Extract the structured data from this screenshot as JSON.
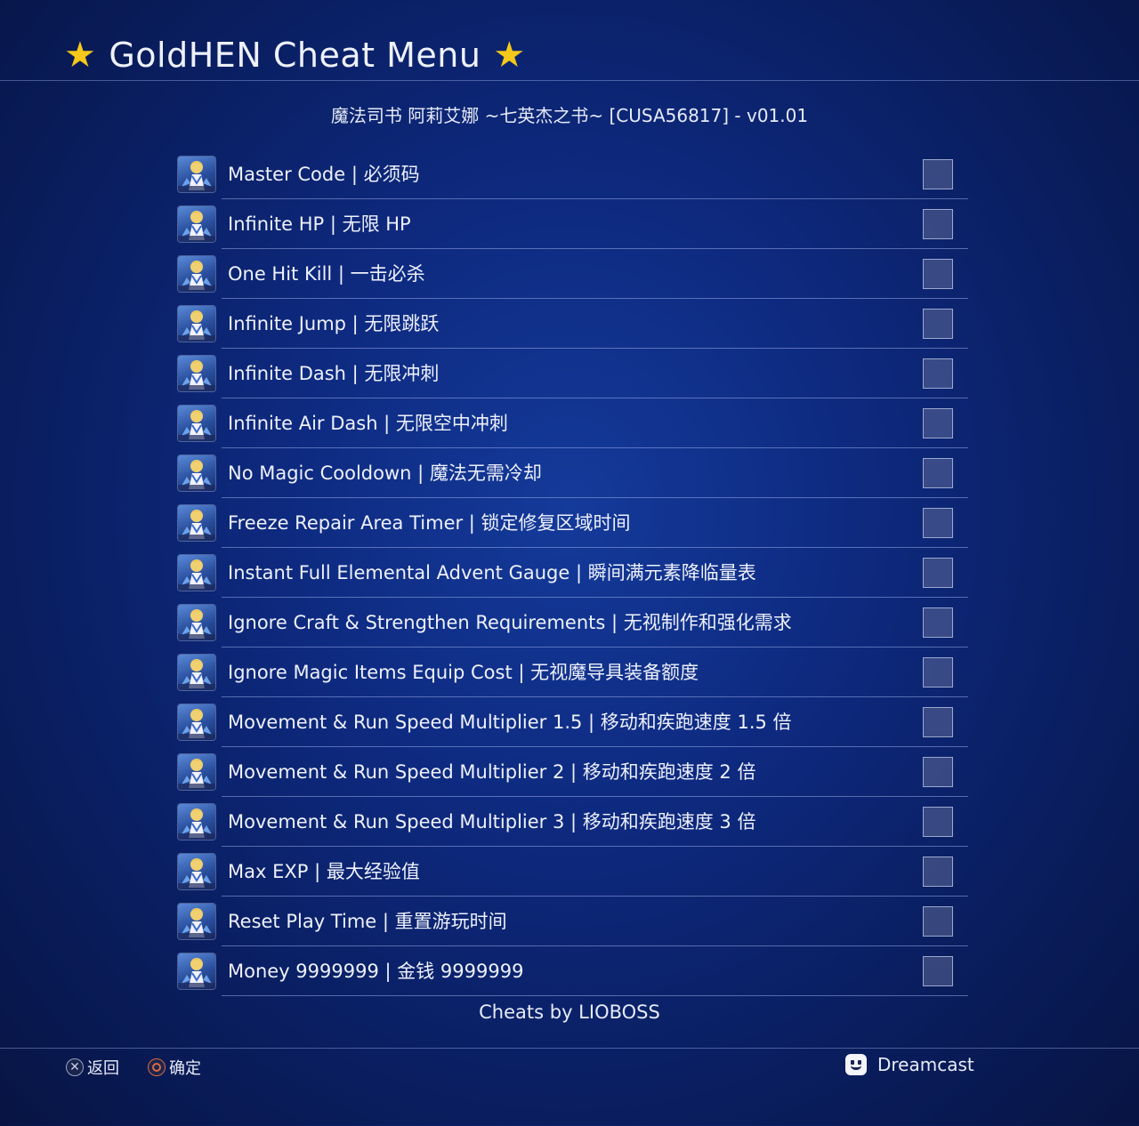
{
  "header": {
    "title": "GoldHEN Cheat Menu",
    "star_icon": "star-icon",
    "star_color": "#f5c81a"
  },
  "game": {
    "title_line": "魔法司书 阿莉艾娜 ~七英杰之书~ [CUSA56817] - v01.01"
  },
  "cheats": [
    {
      "label": "Master Code | 必须码",
      "checked": false
    },
    {
      "label": "Infinite HP | 无限 HP",
      "checked": false
    },
    {
      "label": "One Hit Kill | 一击必杀",
      "checked": false
    },
    {
      "label": "Infinite Jump | 无限跳跃",
      "checked": false
    },
    {
      "label": "Infinite Dash | 无限冲刺",
      "checked": false
    },
    {
      "label": "Infinite Air Dash | 无限空中冲刺",
      "checked": false
    },
    {
      "label": "No Magic Cooldown | 魔法无需冷却",
      "checked": false
    },
    {
      "label": "Freeze Repair Area Timer | 锁定修复区域时间",
      "checked": false
    },
    {
      "label": "Instant Full Elemental Advent Gauge | 瞬间满元素降临量表",
      "checked": false
    },
    {
      "label": "Ignore Craft & Strengthen Requirements | 无视制作和强化需求",
      "checked": false
    },
    {
      "label": "Ignore Magic Items Equip Cost | 无视魔导具装备额度",
      "checked": false
    },
    {
      "label": "Movement & Run Speed Multiplier 1.5 | 移动和疾跑速度 1.5 倍",
      "checked": false
    },
    {
      "label": "Movement & Run Speed Multiplier 2 | 移动和疾跑速度 2 倍",
      "checked": false
    },
    {
      "label": "Movement & Run Speed Multiplier 3 | 移动和疾跑速度 3 倍",
      "checked": false
    },
    {
      "label": "Max EXP | 最大经验值",
      "checked": false
    },
    {
      "label": "Reset Play Time | 重置游玩时间",
      "checked": false
    },
    {
      "label": "Money 9999999 | 金钱 9999999",
      "checked": false
    }
  ],
  "credits": "Cheats by LIOBOSS",
  "footer": {
    "back": {
      "icon": "cross-button-icon",
      "label": "返回"
    },
    "confirm": {
      "icon": "circle-button-icon",
      "label": "确定"
    },
    "theme": {
      "icon": "smiley-face-icon",
      "label": "Dreamcast"
    }
  }
}
